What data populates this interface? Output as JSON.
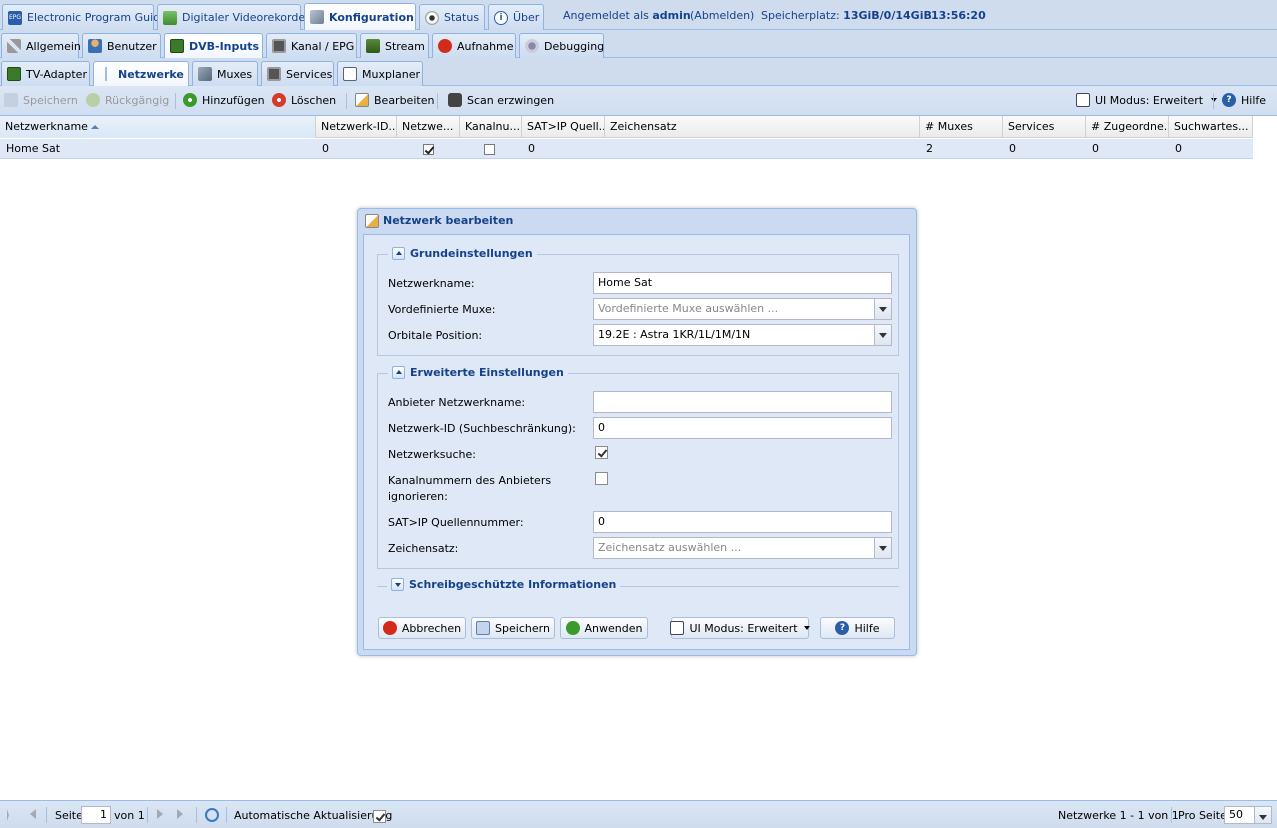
{
  "top_tabs": [
    {
      "label": "Electronic Program Guide"
    },
    {
      "label": "Digitaler Videorekorder"
    },
    {
      "label": "Konfiguration"
    },
    {
      "label": "Status"
    },
    {
      "label": "Über"
    }
  ],
  "session": {
    "logged_in_prefix": "Angemeldet als",
    "user": "admin",
    "logout": "(Abmelden)",
    "storage_label": "Speicherplatz:",
    "storage_value": "13GiB/0/14GiB",
    "time": "13:56:20"
  },
  "config_tabs": [
    {
      "label": "Allgemein"
    },
    {
      "label": "Benutzer"
    },
    {
      "label": "DVB-Inputs"
    },
    {
      "label": "Kanal / EPG"
    },
    {
      "label": "Stream"
    },
    {
      "label": "Aufnahme"
    },
    {
      "label": "Debugging"
    }
  ],
  "dvb_tabs": [
    {
      "label": "TV-Adapter"
    },
    {
      "label": "Netzwerke"
    },
    {
      "label": "Muxes"
    },
    {
      "label": "Services"
    },
    {
      "label": "Muxplaner"
    }
  ],
  "toolbar": {
    "save": "Speichern",
    "undo": "Rückgängig",
    "add": "Hinzufügen",
    "delete": "Löschen",
    "edit": "Bearbeiten",
    "force_scan": "Scan erzwingen",
    "ui_mode": "UI Modus: Erweitert",
    "help": "Hilfe"
  },
  "grid": {
    "columns": [
      "Netzwerkname",
      "Netzwerk-ID...",
      "Netzwe...",
      "Kanalnu...",
      "SAT>IP Quell...",
      "Zeichensatz",
      "# Muxes",
      "Services",
      "# Zugeordne...",
      "Suchwartes..."
    ],
    "rows": [
      {
        "name": "Home Sat",
        "network_id": "0",
        "network_search": true,
        "ignore_numbers": false,
        "satip_source": "0",
        "charset": "",
        "muxes": "2",
        "services": "0",
        "assigned": "0",
        "queue": "0"
      }
    ]
  },
  "dialog": {
    "title": "Netzwerk bearbeiten",
    "basic_legend": "Grundeinstellungen",
    "advanced_legend": "Erweiterte Einstellungen",
    "readonly_legend": "Schreibgeschützte Informationen",
    "fields": {
      "name_label": "Netzwerkname:",
      "name_value": "Home Sat",
      "muxes_label": "Vordefinierte Muxe:",
      "muxes_placeholder": "Vordefinierte Muxe auswählen ...",
      "orbital_label": "Orbitale Position:",
      "orbital_value": "19.2E : Astra 1KR/1L/1M/1N",
      "provider_label": "Anbieter Netzwerkname:",
      "provider_value": "",
      "netid_label": "Netzwerk-ID (Suchbeschränkung):",
      "netid_value": "0",
      "search_label": "Netzwerksuche:",
      "ignore_label_1": "Kanalnummern des Anbieters",
      "ignore_label_2": "ignorieren:",
      "satip_label": "SAT>IP Quellennummer:",
      "satip_value": "0",
      "charset_label": "Zeichensatz:",
      "charset_placeholder": "Zeichensatz auswählen ..."
    },
    "buttons": {
      "cancel": "Abbrechen",
      "save": "Speichern",
      "apply": "Anwenden",
      "ui_mode": "UI Modus: Erweitert",
      "help": "Hilfe"
    }
  },
  "pager": {
    "page_label": "Seite",
    "page_value": "1",
    "of_label": "von 1",
    "auto_refresh": "Automatische Aktualisierung",
    "summary": "Netzwerke 1 - 1 von 1",
    "per_page_label": "Pro Seite",
    "per_page_value": "50"
  },
  "colors": {
    "accent": "#15428b",
    "panel": "#cfdcee",
    "selected_row": "#dfe8f6"
  }
}
